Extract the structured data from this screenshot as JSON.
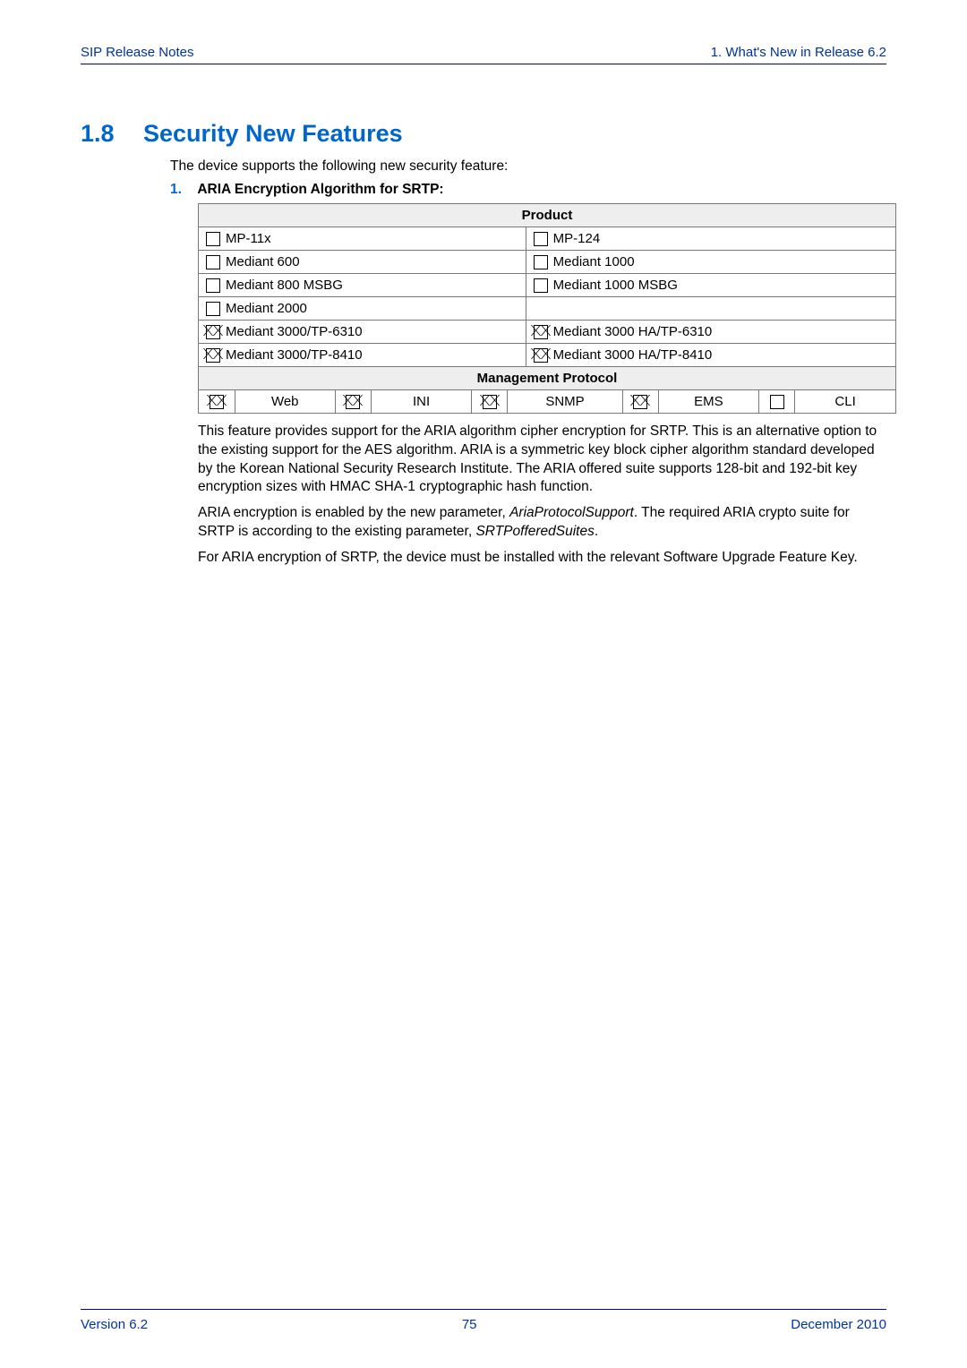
{
  "header": {
    "left": "SIP Release Notes",
    "right": "1. What's New in Release 6.2"
  },
  "section": {
    "number": "1.8",
    "title": "Security New Features"
  },
  "intro": "The device supports the following new security feature:",
  "list_number": "1.",
  "list_heading": "ARIA Encryption Algorithm for SRTP:",
  "table": {
    "product_header": "Product",
    "rows": [
      {
        "l_checked": false,
        "l_label": "MP-11x",
        "r_checked": false,
        "r_label": "MP-124"
      },
      {
        "l_checked": false,
        "l_label": "Mediant 600",
        "r_checked": false,
        "r_label": "Mediant 1000"
      },
      {
        "l_checked": false,
        "l_label": "Mediant 800 MSBG",
        "r_checked": false,
        "r_label": "Mediant 1000 MSBG"
      },
      {
        "l_checked": false,
        "l_label": "Mediant 2000",
        "r_empty": true
      },
      {
        "l_checked": true,
        "l_label": "Mediant 3000/TP-6310",
        "r_checked": true,
        "r_label": "Mediant 3000 HA/TP-6310"
      },
      {
        "l_checked": true,
        "l_label": "Mediant 3000/TP-8410",
        "r_checked": true,
        "r_label": "Mediant 3000 HA/TP-8410"
      }
    ],
    "mgmt_header": "Management Protocol",
    "mgmt": [
      {
        "checked": true,
        "label": "Web"
      },
      {
        "checked": true,
        "label": "INI"
      },
      {
        "checked": true,
        "label": "SNMP"
      },
      {
        "checked": true,
        "label": "EMS"
      },
      {
        "checked": false,
        "label": "CLI"
      }
    ]
  },
  "para1": "This feature provides support for the ARIA algorithm cipher encryption for SRTP. This is an alternative option to the existing support for the AES algorithm. ARIA is a symmetric key block cipher algorithm standard developed by the Korean National Security Research Institute. The ARIA offered suite supports 128-bit and 192-bit key encryption sizes with HMAC SHA-1 cryptographic hash function.",
  "para2_a": "ARIA encryption is enabled by the new parameter, ",
  "para2_em1": "AriaProtocolSupport",
  "para2_b": ". The required ARIA crypto suite for SRTP is according to the existing parameter, ",
  "para2_em2": "SRTPofferedSuites",
  "para2_c": ".",
  "para3": "For ARIA encryption of SRTP, the device must be installed with the relevant Software Upgrade Feature Key.",
  "footer": {
    "left": "Version 6.2",
    "center": "75",
    "right": "December 2010"
  }
}
